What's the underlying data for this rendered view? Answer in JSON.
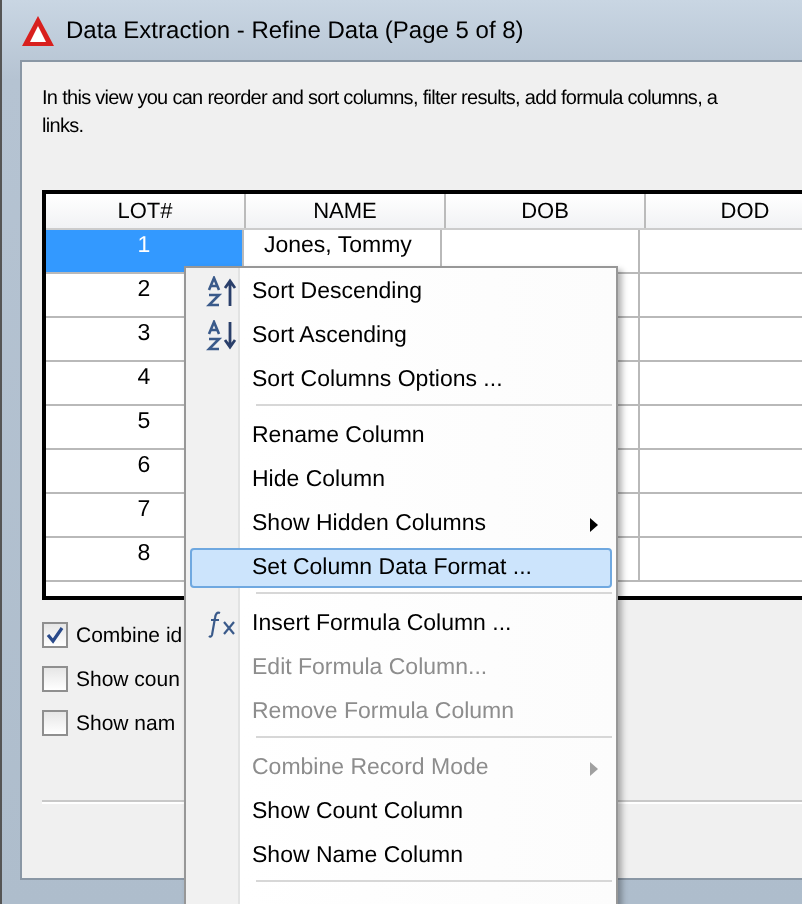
{
  "window": {
    "title": "Data Extraction - Refine Data (Page 5 of 8)"
  },
  "description": [
    "In this view you can reorder and sort columns, filter results, add formula columns, a",
    "links."
  ],
  "table": {
    "columns": [
      "LOT#",
      "NAME",
      "DOB",
      "DOD"
    ],
    "rows": [
      {
        "cells": [
          "1",
          "Jones, Tommy",
          "",
          ""
        ],
        "selected": true
      },
      {
        "cells": [
          "2",
          "",
          "",
          ""
        ],
        "selected": false
      },
      {
        "cells": [
          "3",
          "",
          "",
          ""
        ],
        "selected": false
      },
      {
        "cells": [
          "4",
          "",
          "",
          ""
        ],
        "selected": false
      },
      {
        "cells": [
          "5",
          "",
          "",
          ""
        ],
        "selected": false
      },
      {
        "cells": [
          "6",
          "",
          "",
          ""
        ],
        "selected": false
      },
      {
        "cells": [
          "7",
          "",
          "",
          ""
        ],
        "selected": false
      },
      {
        "cells": [
          "8",
          "",
          "",
          ""
        ],
        "selected": false
      }
    ]
  },
  "options": [
    {
      "label": "Combine id",
      "checked": true
    },
    {
      "label": "Show coun",
      "checked": false
    },
    {
      "label": "Show nam",
      "checked": false
    }
  ],
  "context_menu": [
    {
      "kind": "item",
      "label": "Sort Descending",
      "disabled": false,
      "submenu": false,
      "selected": false
    },
    {
      "kind": "item",
      "label": "Sort Ascending",
      "disabled": false,
      "submenu": false,
      "selected": false
    },
    {
      "kind": "item",
      "label": "Sort Columns Options ...",
      "disabled": false,
      "submenu": false,
      "selected": false
    },
    {
      "kind": "separator"
    },
    {
      "kind": "item",
      "label": "Rename Column",
      "disabled": false,
      "submenu": false,
      "selected": false
    },
    {
      "kind": "item",
      "label": "Hide Column",
      "disabled": false,
      "submenu": false,
      "selected": false
    },
    {
      "kind": "item",
      "label": "Show Hidden Columns",
      "disabled": false,
      "submenu": true,
      "selected": false
    },
    {
      "kind": "item",
      "label": "Set Column Data Format ...",
      "disabled": false,
      "submenu": false,
      "selected": true
    },
    {
      "kind": "separator"
    },
    {
      "kind": "item",
      "label": "Insert Formula Column ...",
      "disabled": false,
      "submenu": false,
      "selected": false
    },
    {
      "kind": "item",
      "label": "Edit Formula Column...",
      "disabled": true,
      "submenu": false,
      "selected": false
    },
    {
      "kind": "item",
      "label": "Remove Formula Column",
      "disabled": true,
      "submenu": false,
      "selected": false
    },
    {
      "kind": "separator"
    },
    {
      "kind": "item",
      "label": "Combine Record Mode",
      "disabled": true,
      "submenu": true,
      "selected": false
    },
    {
      "kind": "item",
      "label": "Show Count Column",
      "disabled": false,
      "submenu": false,
      "selected": false
    },
    {
      "kind": "item",
      "label": "Show Name Column",
      "disabled": false,
      "submenu": false,
      "selected": false
    },
    {
      "kind": "separator"
    }
  ]
}
